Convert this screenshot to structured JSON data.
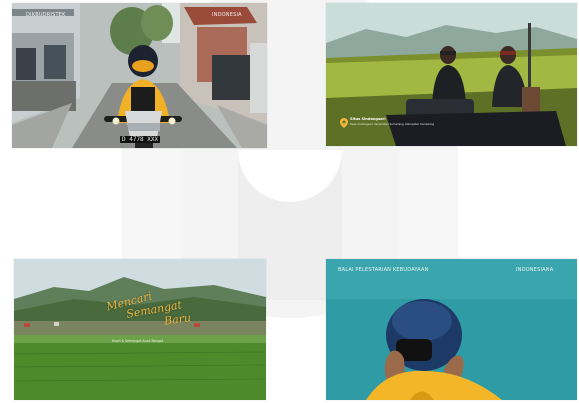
{
  "colors": {
    "accent_yellow": "#f0b640",
    "sky_teal": "#2f9ba4",
    "watermark_gray": "#f3f3f3"
  },
  "frame1": {
    "logo_left": "DIKBUDRISTEK",
    "logo_right": "INDONESIA",
    "plate": "D 4778 XXX"
  },
  "frame2": {
    "location_icon": "map-pin-icon",
    "location_title": "Situs Sindangsari",
    "location_sub": "Desa Sindangsari, Kecamatan Sumedang, Kabupaten Sumedang"
  },
  "frame3": {
    "title_line1": "Mencari",
    "title_line2": "Semangat",
    "title_line3": "Baru",
    "caption": "Kisah & Semangat Anak Bangsa"
  },
  "frame4": {
    "logo_left": "BALAI PELESTARIAN KEBUDAYAAN",
    "logo_right": "INDONESIANA"
  }
}
